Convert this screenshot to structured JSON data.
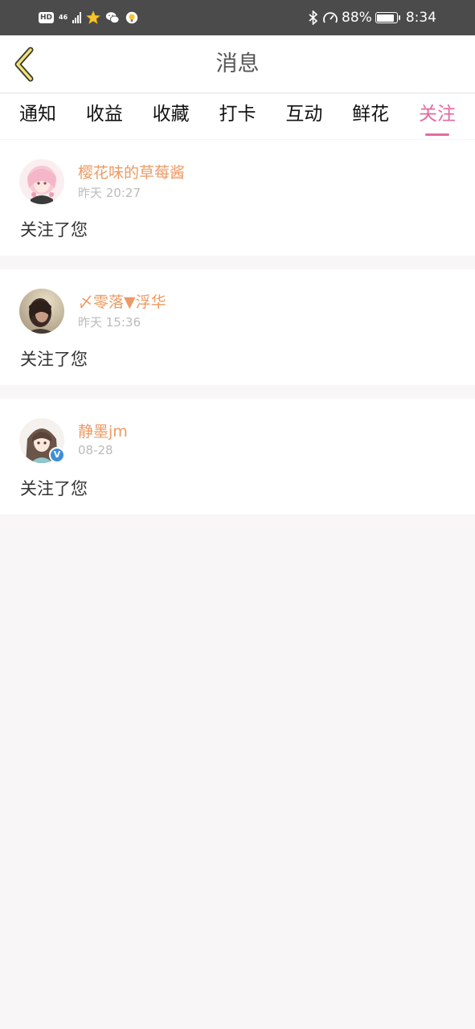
{
  "status_bar": {
    "hd": "HD",
    "network": "46",
    "battery": "88%",
    "battery_level": 0.88,
    "time": "8:34",
    "left_icons": [
      "hd-icon",
      "signal-icon",
      "star-app-icon",
      "wechat-icon",
      "lightbulb-app-icon"
    ],
    "right_icons": [
      "bluetooth-icon",
      "speed-icon",
      "battery-icon"
    ]
  },
  "header": {
    "title": "消息",
    "back_icon": "chevron-left-icon"
  },
  "tabs": [
    {
      "label": "通知",
      "active": false
    },
    {
      "label": "收益",
      "active": false
    },
    {
      "label": "收藏",
      "active": false
    },
    {
      "label": "打卡",
      "active": false
    },
    {
      "label": "互动",
      "active": false
    },
    {
      "label": "鲜花",
      "active": false
    },
    {
      "label": "关注",
      "active": true
    }
  ],
  "colors": {
    "accent": "#e46aa0",
    "username": "#ec9a63",
    "verified": "#3d8fd6"
  },
  "messages": [
    {
      "username": "樱花味的草莓酱",
      "time": "昨天 20:27",
      "action": "关注了您",
      "verified": false,
      "avatar_icon": "anime-girl-pink-avatar"
    },
    {
      "username": "〆零落▼浮华",
      "time": "昨天 15:36",
      "action": "关注了您",
      "verified": false,
      "avatar_icon": "girl-photo-avatar"
    },
    {
      "username": "静墨jm",
      "time": "08-28",
      "action": "关注了您",
      "verified": true,
      "avatar_icon": "anime-girl-brown-avatar"
    }
  ]
}
